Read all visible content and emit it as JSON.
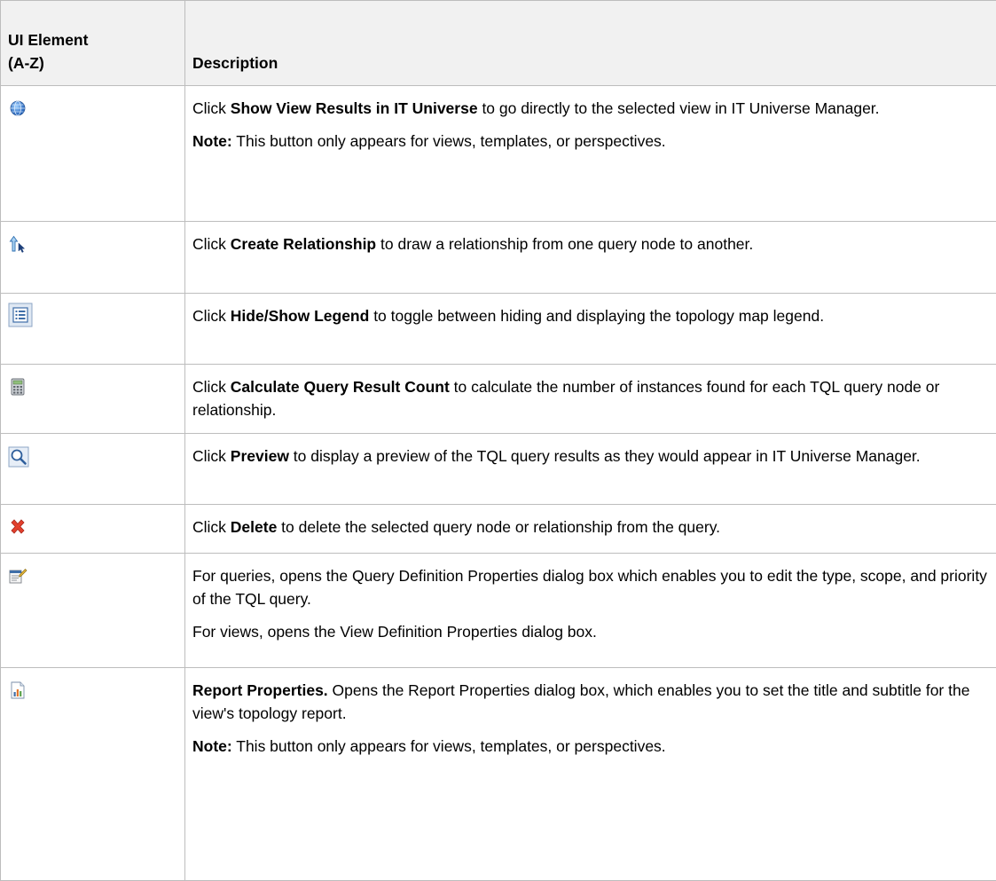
{
  "header": {
    "col1_line1": "UI Element",
    "col1_line2": "(A-Z)",
    "col2": "Description"
  },
  "rows": [
    {
      "icon": "globe-icon",
      "paras": [
        {
          "pre": "Click ",
          "bold": "Show View Results in IT Universe",
          "post": " to go directly to the selected view in IT Universe Manager."
        },
        {
          "pre": "",
          "bold": "Note:",
          "post": " This button only appears for views, templates, or perspectives."
        }
      ]
    },
    {
      "icon": "create-relationship-icon",
      "paras": [
        {
          "pre": "Click ",
          "bold": "Create Relationship",
          "post": " to draw a relationship from one query node to another."
        }
      ]
    },
    {
      "icon": "legend-icon",
      "paras": [
        {
          "pre": "Click ",
          "bold": "Hide/Show Legend",
          "post": " to toggle between hiding and displaying the topology map legend."
        }
      ]
    },
    {
      "icon": "calculator-icon",
      "paras": [
        {
          "pre": "Click ",
          "bold": "Calculate Query Result Count",
          "post": " to calculate the number of instances found for each TQL query node or relationship."
        }
      ]
    },
    {
      "icon": "preview-magnifier-icon",
      "paras": [
        {
          "pre": "Click ",
          "bold": "Preview",
          "post": " to display a preview of the TQL query results as they would appear in IT Universe Manager."
        }
      ]
    },
    {
      "icon": "delete-x-icon",
      "paras": [
        {
          "pre": "Click ",
          "bold": "Delete",
          "post": " to delete the selected query node or relationship from the query."
        }
      ]
    },
    {
      "icon": "properties-icon",
      "paras": [
        {
          "pre": "For queries, opens the Query Definition Properties dialog box which enables you to edit the type, scope, and priority of the TQL query.",
          "bold": "",
          "post": ""
        },
        {
          "pre": "For views, opens the View Definition Properties dialog box.",
          "bold": "",
          "post": ""
        }
      ]
    },
    {
      "icon": "report-chart-icon",
      "paras": [
        {
          "pre": "",
          "bold": "Report Properties.",
          "post": " Opens the Report Properties dialog box, which enables you to set the title and subtitle for the view's topology report."
        },
        {
          "pre": "",
          "bold": "Note:",
          "post": " This button only appears for views, templates, or perspectives."
        }
      ]
    }
  ],
  "colors": {
    "border": "#bdbdbd",
    "header_bg": "#f1f1f1"
  }
}
